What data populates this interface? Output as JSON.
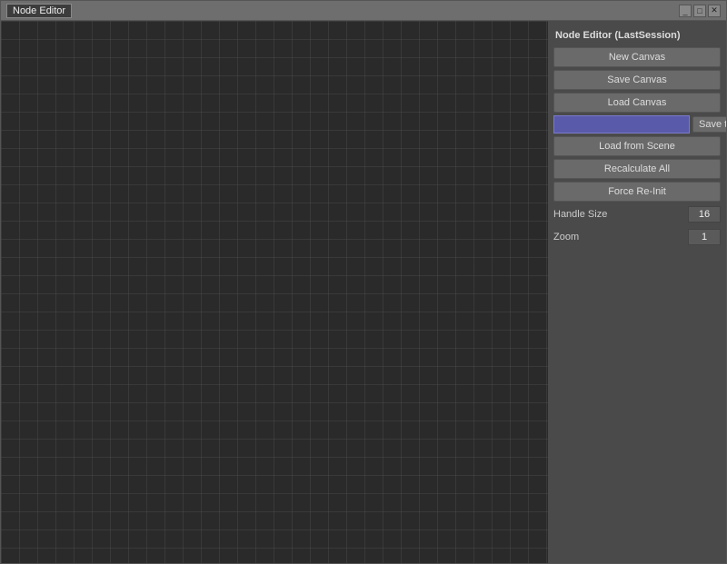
{
  "window": {
    "title": "Node Editor",
    "controls": {
      "minimize": "_",
      "maximize": "□",
      "close": "✕"
    }
  },
  "sidebar": {
    "title": "Node Editor (LastSession)",
    "buttons": {
      "new_canvas": "New Canvas",
      "save_canvas": "Save Canvas",
      "load_canvas": "Load Canvas",
      "save_to_scene": "Save to Scene",
      "load_from_scene": "Load from Scene",
      "recalculate_all": "Recalculate All",
      "force_re_init": "Force Re-Init"
    },
    "save_input_placeholder": "",
    "properties": {
      "handle_size_label": "Handle Size",
      "handle_size_value": "16",
      "zoom_label": "Zoom",
      "zoom_value": "1"
    }
  }
}
